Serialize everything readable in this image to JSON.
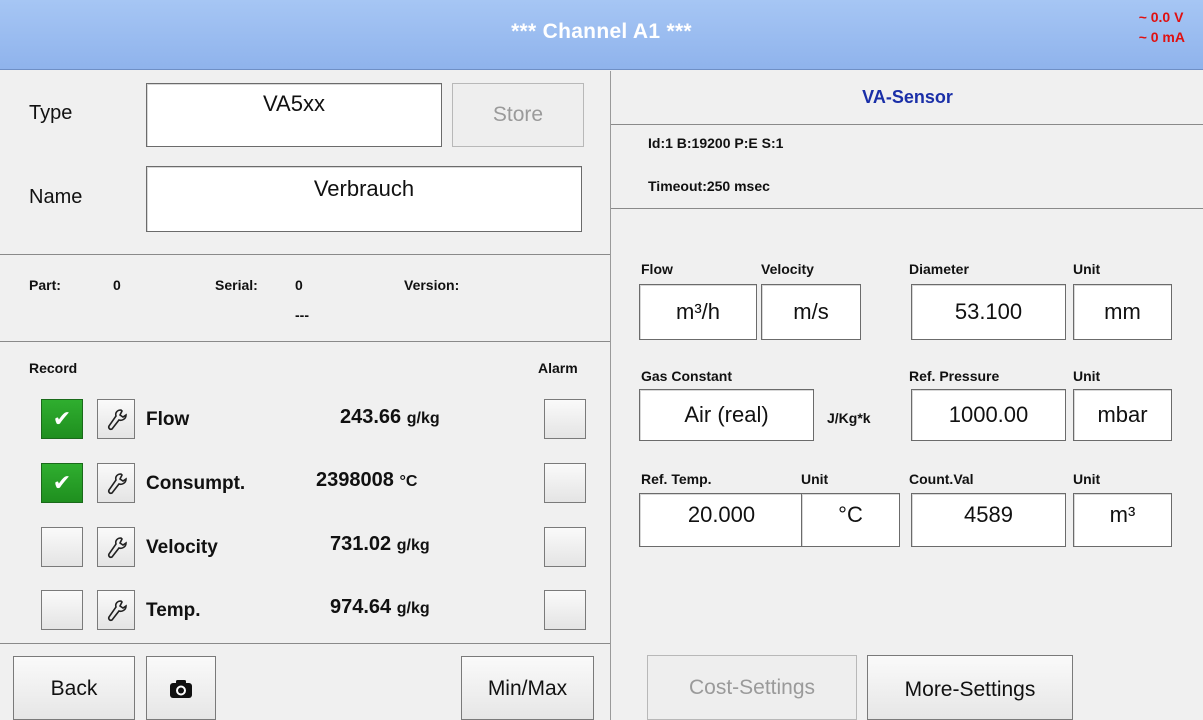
{
  "header": {
    "title": "*** Channel A1 ***",
    "voltage": "~ 0.0 V",
    "current": "~ 0 mA"
  },
  "left": {
    "type_label": "Type",
    "type_value": "VA5xx",
    "store_label": "Store",
    "name_label": "Name",
    "name_value": "Verbrauch",
    "part_label": "Part:",
    "part_value": "0",
    "serial_label": "Serial:",
    "serial_value": "0",
    "version_label": "Version:",
    "version_value": "---",
    "record_label": "Record",
    "alarm_label": "Alarm",
    "rows": [
      {
        "name": "Flow",
        "value": "243.66",
        "unit": "g/kg",
        "recorded": true
      },
      {
        "name": "Consumpt.",
        "value": "2398008",
        "unit": "°C",
        "recorded": true
      },
      {
        "name": "Velocity",
        "value": "731.02",
        "unit": "g/kg",
        "recorded": false
      },
      {
        "name": "Temp.",
        "value": "974.64",
        "unit": "g/kg",
        "recorded": false
      }
    ],
    "check_glyph": "✔",
    "back_label": "Back",
    "minmax_label": "Min/Max"
  },
  "right": {
    "sensor_title": "VA-Sensor",
    "id_line": "Id:1 B:19200 P:E S:1",
    "timeout_line": "Timeout:250 msec",
    "flow_label": "Flow",
    "velocity_label": "Velocity",
    "diameter_label": "Diameter",
    "unit_label": "Unit",
    "flow_unit": "m³/h",
    "velocity_unit": "m/s",
    "diameter_value": "53.100",
    "diameter_unit": "mm",
    "gas_label": "Gas Constant",
    "gas_value": "Air (real)",
    "gas_unit": "J/Kg*k",
    "refpress_label": "Ref. Pressure",
    "refpress_value": "1000.00",
    "refpress_unit": "mbar",
    "reftemp_label": "Ref. Temp.",
    "reftemp_value": "20.000",
    "reftemp_unit": "°C",
    "count_label": "Count.Val",
    "count_value": "4589",
    "count_unit": "m³",
    "cost_label": "Cost-Settings",
    "more_label": "More-Settings"
  }
}
